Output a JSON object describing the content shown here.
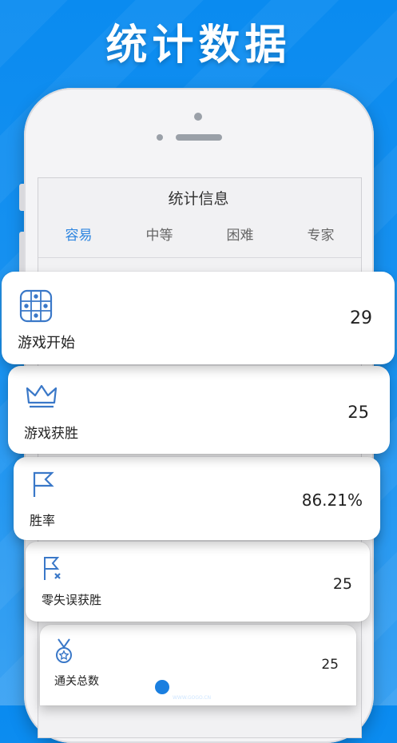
{
  "banner": {
    "title": "统计数据"
  },
  "app": {
    "title": "统计信息",
    "tabs": [
      {
        "label": "容易",
        "active": true
      },
      {
        "label": "中等",
        "active": false
      },
      {
        "label": "困难",
        "active": false
      },
      {
        "label": "专家",
        "active": false
      }
    ]
  },
  "stats": [
    {
      "icon": "grid-icon",
      "label": "游戏开始",
      "value": "29"
    },
    {
      "icon": "crown-icon",
      "label": "游戏获胜",
      "value": "25"
    },
    {
      "icon": "flag-icon",
      "label": "胜率",
      "value": "86.21%"
    },
    {
      "icon": "flag-x-icon",
      "label": "零失误获胜",
      "value": "25"
    },
    {
      "icon": "medal-icon",
      "label": "通关总数",
      "value": "25"
    }
  ],
  "watermark": {
    "brand": "GOGO手游网",
    "url": "WWW.GOGO.CN"
  },
  "colors": {
    "accent": "#2f86e0",
    "background": "#0a8bf0",
    "icon": "#3a78c8"
  }
}
